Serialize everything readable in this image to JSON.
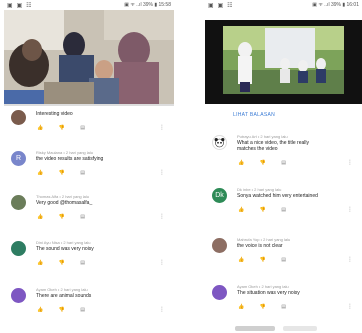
{
  "left": {
    "status": {
      "icons": "▣ ▣ ☷",
      "right": "▣ ᯤ ..ıl 39% ▮ 15:58"
    },
    "video_progress": 0.0,
    "comments": [
      {
        "meta": "",
        "text": "Interesting video",
        "text2": "",
        "avatar_letter": "",
        "avatar_color": "#7a5b4c"
      },
      {
        "meta": "Risky Maulana • 2 hari yang lalu",
        "text": "the video results are satisfying",
        "text2": "",
        "avatar_letter": "R",
        "avatar_color": "#7986cb"
      },
      {
        "meta": "Thomas Alfa • 2 hari yang lalu",
        "text": "Very good @thomasalfa_",
        "text2": "",
        "avatar_letter": "",
        "avatar_color": "#6b7d5a"
      },
      {
        "meta": "Dini Ayu Nisa • 2 hari yang lalu",
        "text": "The sound was very noisy",
        "text2": "",
        "avatar_letter": "",
        "avatar_color": "#2e7d62"
      },
      {
        "meta": "Ayam Okeh • 2 hari yang lalu",
        "text": "There are animal sounds",
        "text2": "",
        "avatar_letter": "",
        "avatar_color": "#7e57c2"
      }
    ]
  },
  "right": {
    "status": {
      "icons": "▣ ▣ ☷",
      "right": "▣ ᯤ ..ıl 39% ▮ 16:01"
    },
    "replies_link": "LIHAT BALASAN",
    "comments": [
      {
        "meta": "Putrayu Art • 2 hari yang lalu",
        "text": "What a nice video, the title really",
        "text2": "matches the video",
        "avatar_letter": "",
        "avatar_color": "#222222"
      },
      {
        "meta": "Dk inbe • 2 hari yang lalu",
        "text": "Sonya watched him very entertained",
        "text2": "",
        "avatar_letter": "Dk",
        "avatar_color": "#2e8b57"
      },
      {
        "meta": "Mahrufa Yop • 2 hari yang lalu",
        "text": "the voice is not clear",
        "text2": "",
        "avatar_letter": "",
        "avatar_color": "#8d6e63"
      },
      {
        "meta": "Ayam Okeh • 2 hari yang lalu",
        "text": "The situation was very noisy",
        "text2": "",
        "avatar_letter": "",
        "avatar_color": "#7e57c2"
      }
    ]
  },
  "actions": {
    "like": "👍",
    "dislike": "👎",
    "reply": "▤",
    "more": "⋮"
  }
}
